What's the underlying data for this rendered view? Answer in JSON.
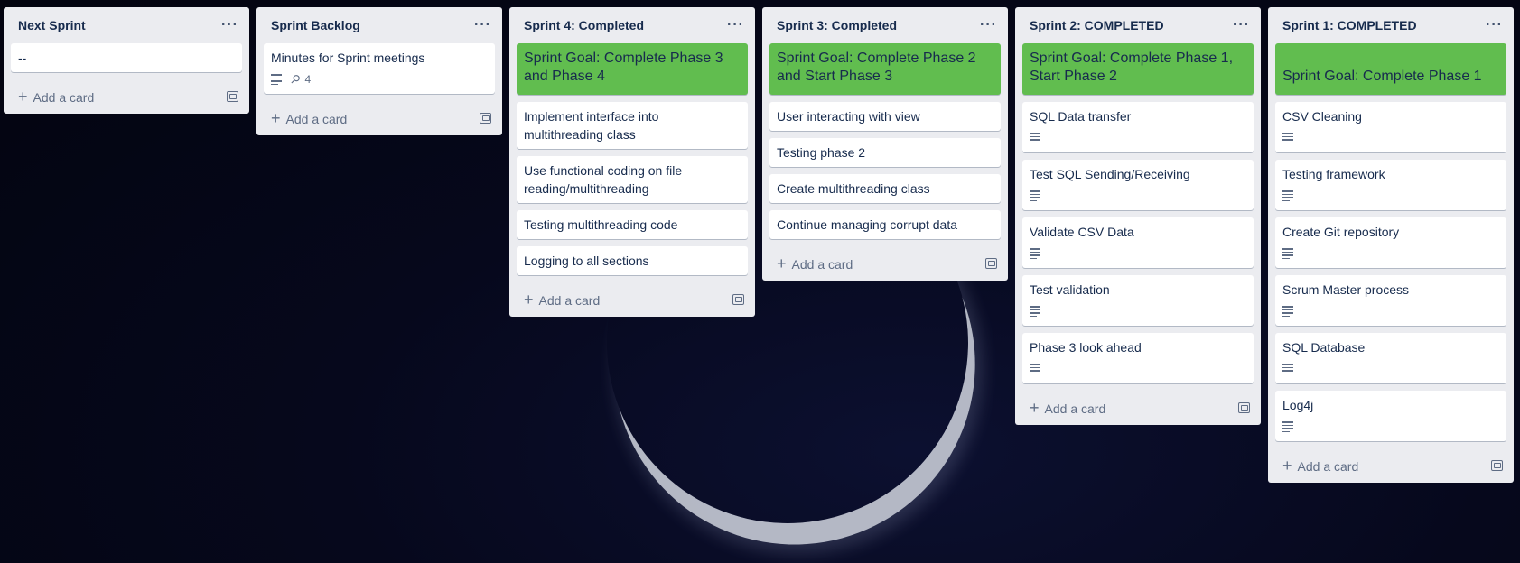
{
  "lists": [
    {
      "title": "Next Sprint",
      "menu": "···",
      "cards": [
        {
          "text": "--"
        }
      ],
      "add_card": "Add a card"
    },
    {
      "title": "Sprint Backlog",
      "menu": "···",
      "cards": [
        {
          "text": "Minutes for Sprint meetings",
          "attachments": "4"
        }
      ],
      "add_card": "Add a card"
    },
    {
      "title": "Sprint 4: Completed",
      "menu": "···",
      "goal": "Sprint Goal: Complete Phase 3 and Phase 4",
      "cards": [
        {
          "text": "Implement interface into multithreading class"
        },
        {
          "text": "Use functional coding on file reading/multithreading"
        },
        {
          "text": "Testing multithreading code"
        },
        {
          "text": "Logging to all sections"
        }
      ],
      "add_card": "Add a card"
    },
    {
      "title": "Sprint 3: Completed",
      "menu": "···",
      "goal": "Sprint Goal: Complete Phase 2 and Start Phase 3",
      "cards": [
        {
          "text": "User interacting with view"
        },
        {
          "text": "Testing phase 2"
        },
        {
          "text": "Create multithreading class"
        },
        {
          "text": "Continue managing corrupt data"
        }
      ],
      "add_card": "Add a card"
    },
    {
      "title": "Sprint 2: COMPLETED",
      "menu": "···",
      "goal": "Sprint Goal: Complete Phase 1, Start Phase 2",
      "cards": [
        {
          "text": "SQL Data transfer"
        },
        {
          "text": "Test SQL Sending/Receiving"
        },
        {
          "text": "Validate CSV Data"
        },
        {
          "text": "Test validation"
        },
        {
          "text": "Phase 3 look ahead"
        }
      ],
      "add_card": "Add a card"
    },
    {
      "title": "Sprint 1: COMPLETED",
      "menu": "···",
      "goal": "Sprint Goal: Complete Phase 1",
      "cards": [
        {
          "text": "CSV Cleaning"
        },
        {
          "text": "Testing framework"
        },
        {
          "text": "Create Git repository"
        },
        {
          "text": "Scrum Master process"
        },
        {
          "text": "SQL Database"
        },
        {
          "text": "Log4j"
        }
      ],
      "add_card": "Add a card"
    }
  ],
  "colors": {
    "goal_label": "#61bd4f",
    "list_bg": "#ebecf0"
  }
}
